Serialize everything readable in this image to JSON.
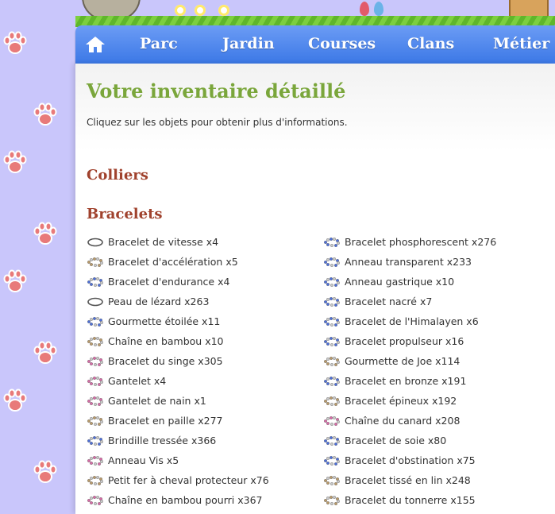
{
  "nav": {
    "home_icon": "home-icon",
    "items": [
      {
        "label": "Parc"
      },
      {
        "label": "Jardin"
      },
      {
        "label": "Courses"
      },
      {
        "label": "Clans"
      },
      {
        "label": "Métier"
      }
    ]
  },
  "page": {
    "title": "Votre inventaire détaillé",
    "intro": "Cliquez sur les objets pour obtenir plus d'informations."
  },
  "sections": {
    "colliers": "Colliers",
    "bracelets": "Bracelets"
  },
  "colors": {
    "nav": "#4a86ee",
    "title": "#7aa63b",
    "section": "#a0422d",
    "background": "#c9c6fb",
    "paw": "#e87a7a"
  },
  "bracelets": {
    "left": [
      {
        "label": "Bracelet de vitesse x4",
        "icon": "ring-icon",
        "color": "#8a8a7a"
      },
      {
        "label": "Bracelet d'accélération x5",
        "icon": "bead-bracelet-icon",
        "color": "#b99a6a"
      },
      {
        "label": "Bracelet d'endurance x4",
        "icon": "bead-bracelet-icon",
        "color": "#4d6fd8"
      },
      {
        "label": "Peau de lézard x263",
        "icon": "ring-icon",
        "color": "#8a8a7a"
      },
      {
        "label": "Gourmette étoilée x11",
        "icon": "bead-bracelet-icon",
        "color": "#4d6fd8"
      },
      {
        "label": "Chaîne en bambou x10",
        "icon": "bead-bracelet-icon",
        "color": "#b99a6a"
      },
      {
        "label": "Bracelet du singe x305",
        "icon": "bead-bracelet-icon",
        "color": "#d76aa6"
      },
      {
        "label": "Gantelet x4",
        "icon": "bead-bracelet-icon",
        "color": "#d76aa6"
      },
      {
        "label": "Gantelet de nain x1",
        "icon": "bead-bracelet-icon",
        "color": "#d76aa6"
      },
      {
        "label": "Bracelet en paille x277",
        "icon": "bead-bracelet-icon",
        "color": "#b99a6a"
      },
      {
        "label": "Brindille tressée x366",
        "icon": "bead-bracelet-icon",
        "color": "#4d6fd8"
      },
      {
        "label": "Anneau Vis x5",
        "icon": "bead-bracelet-icon",
        "color": "#d76aa6"
      },
      {
        "label": "Petit fer à cheval protecteur x76",
        "icon": "bead-bracelet-icon",
        "color": "#b99a6a"
      },
      {
        "label": "Chaîne en bambou pourri x367",
        "icon": "bead-bracelet-icon",
        "color": "#d76aa6"
      }
    ],
    "right": [
      {
        "label": "Bracelet phosphorescent x276",
        "icon": "bead-bracelet-icon",
        "color": "#4d6fd8"
      },
      {
        "label": "Anneau transparent x233",
        "icon": "bead-bracelet-icon",
        "color": "#4d6fd8"
      },
      {
        "label": "Anneau gastrique x10",
        "icon": "bead-bracelet-icon",
        "color": "#4d6fd8"
      },
      {
        "label": "Bracelet nacré x7",
        "icon": "bead-bracelet-icon",
        "color": "#4d6fd8"
      },
      {
        "label": "Bracelet de l'Himalayen x6",
        "icon": "bead-bracelet-icon",
        "color": "#4d6fd8"
      },
      {
        "label": "Bracelet propulseur x16",
        "icon": "bead-bracelet-icon",
        "color": "#4d6fd8"
      },
      {
        "label": "Gourmette de Joe x114",
        "icon": "bead-bracelet-icon",
        "color": "#b99a6a"
      },
      {
        "label": "Bracelet en bronze x191",
        "icon": "bead-bracelet-icon",
        "color": "#4d6fd8"
      },
      {
        "label": "Bracelet épineux x192",
        "icon": "bead-bracelet-icon",
        "color": "#b99a6a"
      },
      {
        "label": "Chaîne du canard x208",
        "icon": "bead-bracelet-icon",
        "color": "#d76aa6"
      },
      {
        "label": "Bracelet de soie x80",
        "icon": "bead-bracelet-icon",
        "color": "#4d6fd8"
      },
      {
        "label": "Bracelet d'obstination x75",
        "icon": "bead-bracelet-icon",
        "color": "#4d6fd8"
      },
      {
        "label": "Bracelet tissé en lin x248",
        "icon": "bead-bracelet-icon",
        "color": "#b99a6a"
      },
      {
        "label": "Bracelet du tonnerre x155",
        "icon": "bead-bracelet-icon",
        "color": "#b99a6a"
      }
    ]
  }
}
